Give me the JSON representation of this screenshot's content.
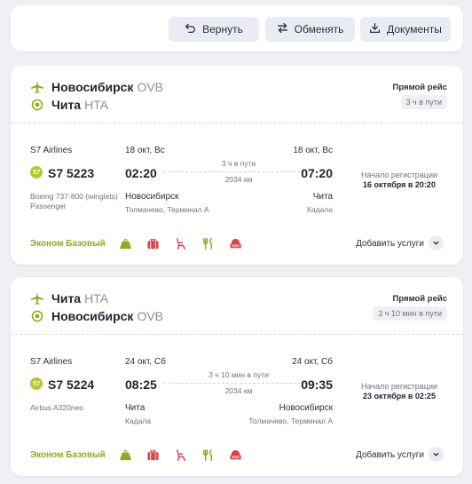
{
  "colors": {
    "accent_green": "#8cad1e",
    "s7_green": "#b5c630",
    "amenity_red": "#e0424b",
    "background": "#eef0f4"
  },
  "toolbar": {
    "return_label": "Вернуть",
    "return_icon": "undo-icon",
    "exchange_label": "Обменять",
    "exchange_icon": "swap-icon",
    "docs_label": "Документы",
    "docs_icon": "download-icon"
  },
  "flights": [
    {
      "from_city": "Новосибирск",
      "from_code": "OVB",
      "to_city": "Чита",
      "to_code": "HTA",
      "direct_label": "Прямой рейс",
      "total_duration": "3 ч в пути",
      "airline": "S7 Airlines",
      "airline_logo": "S7",
      "flight_number": "S7 5223",
      "aircraft": "Boeing 737-800 (winglets) Passenger",
      "dep_date": "18 окт, Вс",
      "dep_time": "02:20",
      "dep_city": "Новосибирск",
      "dep_airport": "Толмачево, Терминал A",
      "arr_date": "18 окт, Вс",
      "arr_time": "07:20",
      "arr_city": "Чита",
      "arr_airport": "Кадала",
      "segment_duration": "3 ч в пути",
      "distance": "2034 км",
      "checkin_label": "Начало регистрации",
      "checkin_value": "16 октября в 20:20",
      "fare": "Эконом Базовый",
      "amenities": [
        "baggage-weight-icon",
        "suitcase-icon",
        "seat-icon",
        "meal-icon",
        "comfort-seat-icon"
      ],
      "services_label": "Добавить услуги"
    },
    {
      "from_city": "Чита",
      "from_code": "HTA",
      "to_city": "Новосибирск",
      "to_code": "OVB",
      "direct_label": "Прямой рейс",
      "total_duration": "3 ч 10 мин в пути",
      "airline": "S7 Airlines",
      "airline_logo": "S7",
      "flight_number": "S7 5224",
      "aircraft": "Airbus A320neo",
      "dep_date": "24 окт, Сб",
      "dep_time": "08:25",
      "dep_city": "Чита",
      "dep_airport": "Кадала",
      "arr_date": "24 окт, Сб",
      "arr_time": "09:35",
      "arr_city": "Новосибирск",
      "arr_airport": "Толмачево, Терминал A",
      "segment_duration": "3 ч 10 мин в пути",
      "distance": "2034 км",
      "checkin_label": "Начало регистрации",
      "checkin_value": "23 октября в 02:25",
      "fare": "Эконом Базовый",
      "amenities": [
        "baggage-weight-icon",
        "suitcase-icon",
        "seat-icon",
        "meal-icon",
        "comfort-seat-icon"
      ],
      "services_label": "Добавить услуги"
    }
  ]
}
